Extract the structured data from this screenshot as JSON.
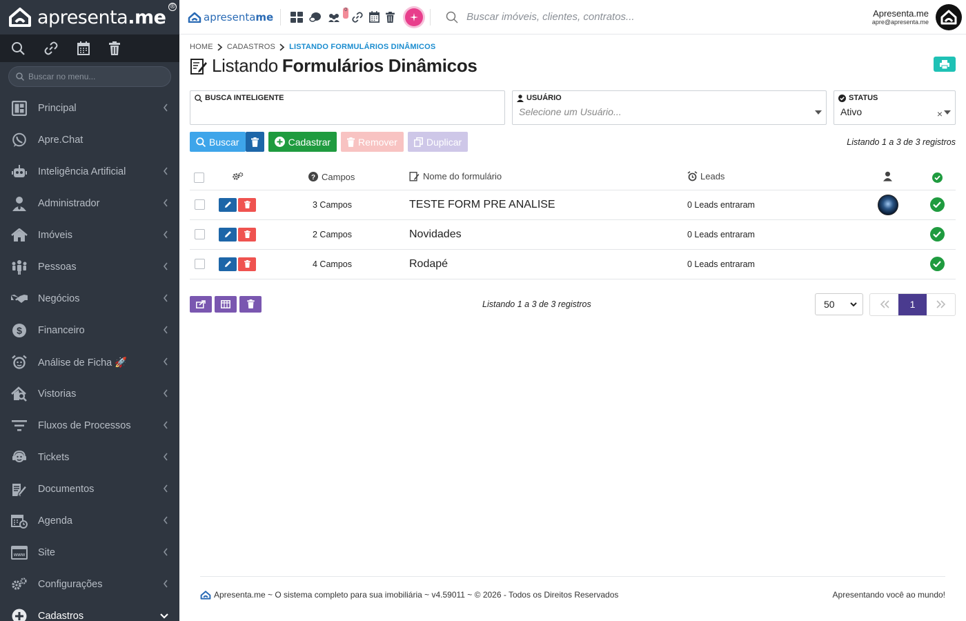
{
  "brand": {
    "name_light": "apresenta",
    "name_bold": ".me",
    "reg": "®"
  },
  "topbar": {
    "logo_light": "apresenta",
    "logo_bold": "me",
    "search_placeholder": "Buscar imóveis, clientes, contratos...",
    "user_name": "Apresenta.me",
    "user_email": "apre@apresenta.me",
    "icons": [
      "dashboard-icon",
      "chat-bubbles-icon",
      "users-icon",
      "link-icon",
      "calendar-icon",
      "trash-icon"
    ],
    "notification_badge": "0"
  },
  "sidebar": {
    "quick_icons": [
      "search-icon",
      "link-icon",
      "calendar-icon",
      "trash-icon"
    ],
    "search_placeholder": "Buscar no menu...",
    "items": [
      {
        "label": "Principal",
        "icon": "dashboard-icon",
        "chevron": true
      },
      {
        "label": "Apre.Chat",
        "icon": "whatsapp-icon",
        "chevron": false
      },
      {
        "label": "Inteligência Artificial",
        "icon": "robot-icon",
        "chevron": true
      },
      {
        "label": "Administrador",
        "icon": "user-tie-icon",
        "chevron": true
      },
      {
        "label": "Imóveis",
        "icon": "home-icon",
        "chevron": true
      },
      {
        "label": "Pessoas",
        "icon": "people-icon",
        "chevron": true
      },
      {
        "label": "Negócios",
        "icon": "handshake-icon",
        "chevron": true
      },
      {
        "label": "Financeiro",
        "icon": "dollar-icon",
        "chevron": true
      },
      {
        "label": "Análise de Ficha 🚀",
        "icon": "alarm-icon",
        "chevron": true
      },
      {
        "label": "Vistorias",
        "icon": "house-search-icon",
        "chevron": true
      },
      {
        "label": "Fluxos de Processos",
        "icon": "filter-icon",
        "chevron": true
      },
      {
        "label": "Tickets",
        "icon": "support-icon",
        "chevron": true
      },
      {
        "label": "Documentos",
        "icon": "document-edit-icon",
        "chevron": true
      },
      {
        "label": "Agenda",
        "icon": "calendar-clock-icon",
        "chevron": true
      },
      {
        "label": "Site",
        "icon": "www-icon",
        "chevron": true
      },
      {
        "label": "Configurações",
        "icon": "gears-icon",
        "chevron": true
      },
      {
        "label": "Cadastros",
        "icon": "plus-circle-icon",
        "chevron": true,
        "active": true
      }
    ]
  },
  "breadcrumb": {
    "home": "HOME",
    "section": "CADASTROS",
    "current": "LISTANDO FORMULÁRIOS DINÂMICOS"
  },
  "page": {
    "title_light": "Listando",
    "title_bold": "Formulários Dinâmicos"
  },
  "filters": {
    "smart_search": {
      "label": "BUSCA INTELIGENTE",
      "value": ""
    },
    "user": {
      "label": "USUÁRIO",
      "placeholder": "Selecione um Usuário..."
    },
    "status": {
      "label": "STATUS",
      "value": "Ativo",
      "clear": "×"
    }
  },
  "actions": {
    "search": "Buscar",
    "create": "Cadastrar",
    "remove": "Remover",
    "duplicate": "Duplicar",
    "listing": "Listando 1 a 3 de 3 registros"
  },
  "table": {
    "headers": {
      "fields": "Campos",
      "name": "Nome do formulário",
      "leads": "Leads"
    },
    "rows": [
      {
        "fields": "3 Campos",
        "name": "TESTE FORM PRE ANALISE",
        "leads": "0 Leads entraram",
        "has_avatar": true
      },
      {
        "fields": "2 Campos",
        "name": "Novidades",
        "leads": "0 Leads entraram",
        "has_avatar": false
      },
      {
        "fields": "4 Campos",
        "name": "Rodapé",
        "leads": "0 Leads entraram",
        "has_avatar": false
      }
    ]
  },
  "pagination": {
    "listing": "Listando 1 a 3 de 3 registros",
    "per_page": "50",
    "current_page": "1"
  },
  "footer": {
    "left": "Apresenta.me ~ O sistema completo para sua imobiliária ~ v4.59011 ~ © 2026 - Todos os Direitos Reservados",
    "right": "Apresentando você ao mundo!"
  },
  "colors": {
    "sidebar": "#2f3640",
    "accent": "#1a8ccf",
    "green": "#1f9b3f",
    "purple": "#7a57b0",
    "pager_active": "#4a3b8f"
  }
}
